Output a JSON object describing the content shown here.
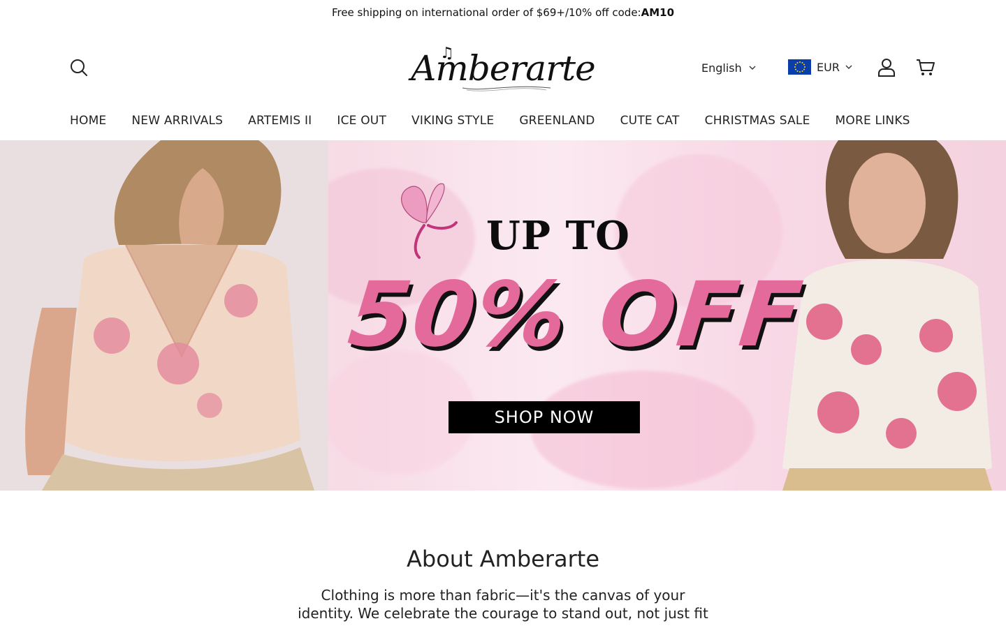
{
  "announcement": {
    "text": "Free shipping on international order of $69+/10% off code:",
    "code": "AM10"
  },
  "header": {
    "logo_text": "Amberarte",
    "language": "English",
    "currency": "EUR"
  },
  "icons": {
    "search": "search-icon",
    "account": "user-icon",
    "cart": "cart-icon",
    "chevron": "chevron-down-icon",
    "flag": "eu-flag-icon"
  },
  "nav": {
    "items": [
      {
        "label": "HOME"
      },
      {
        "label": "NEW ARRIVALS"
      },
      {
        "label": "ARTEMIS II"
      },
      {
        "label": "ICE OUT"
      },
      {
        "label": "VIKING STYLE"
      },
      {
        "label": "GREENLAND"
      },
      {
        "label": "CUTE CAT"
      },
      {
        "label": "CHRISTMAS SALE"
      },
      {
        "label": "MORE LINKS"
      }
    ]
  },
  "hero": {
    "headline_top": "UP TO",
    "headline_main": "50% OFF",
    "cta_label": "SHOP NOW"
  },
  "about": {
    "title": "About Amberarte",
    "text": "Clothing is more than fabric—it's the canvas of your identity. We celebrate the courage to stand out, not just fit"
  },
  "colors": {
    "accent_pink": "#e46a9c",
    "button_black": "#000000",
    "hero_bg": "#f7dce6"
  }
}
